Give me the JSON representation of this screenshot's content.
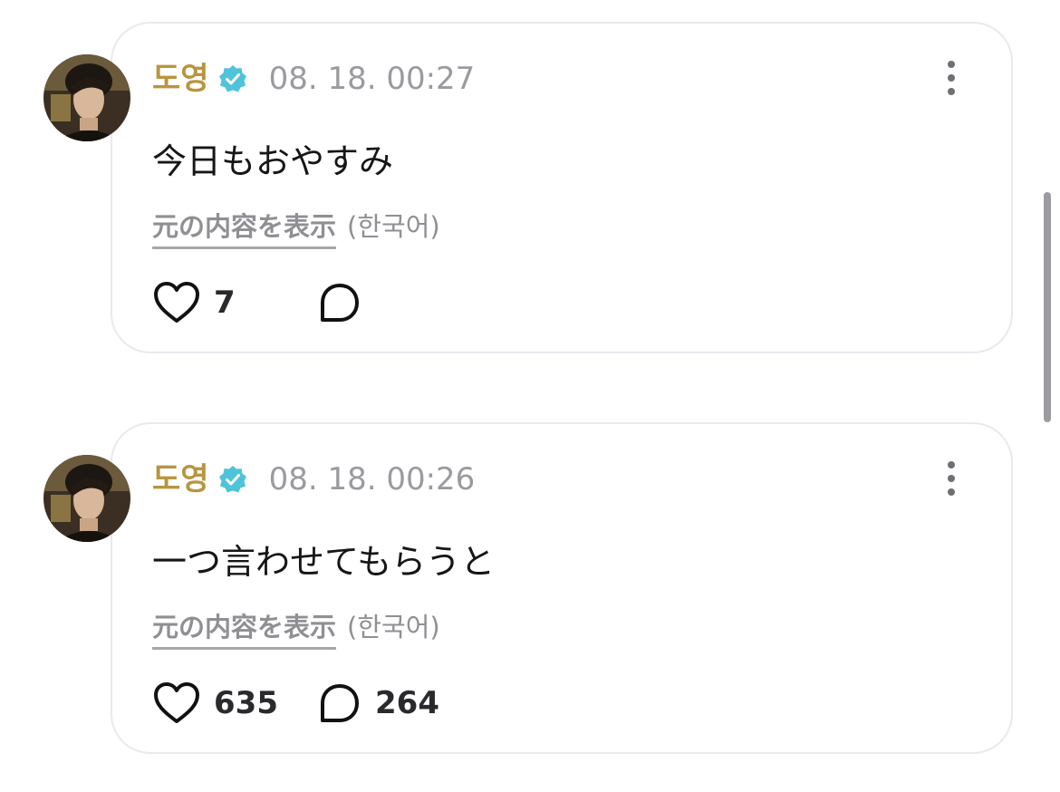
{
  "colors": {
    "author": "#b8953f",
    "verified": "#4fc3d9",
    "timestamp": "#9a9aa0",
    "card_border": "#e9e9ee"
  },
  "posts": [
    {
      "author": "도영",
      "verified_icon": "verified-badge-icon",
      "timestamp": "08. 18. 00:27",
      "text": "今日もおやすみ",
      "show_original": "元の内容を表示",
      "language": "(한국어)",
      "likes": "7",
      "comments": ""
    },
    {
      "author": "도영",
      "verified_icon": "verified-badge-icon",
      "timestamp": "08. 18. 00:26",
      "text": "一つ言わせてもらうと",
      "show_original": "元の内容を表示",
      "language": "(한국어)",
      "likes": "635",
      "comments": "264"
    }
  ]
}
